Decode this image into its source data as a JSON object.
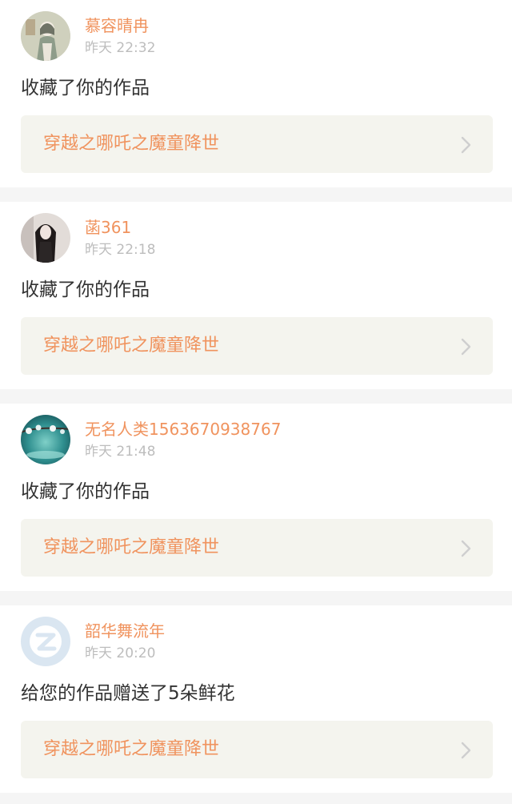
{
  "notifications": [
    {
      "user": "慕容晴冉",
      "time": "昨天 22:32",
      "action": "收藏了你的作品",
      "work_title": "穿越之哪吒之魔童降世",
      "avatar_icon": "avatar-girl-lantern",
      "avatar_colors": [
        "#c9c9b6",
        "#8d9a8a"
      ]
    },
    {
      "user": "菡361",
      "time": "昨天 22:18",
      "action": "收藏了你的作品",
      "work_title": "穿越之哪吒之魔童降世",
      "avatar_icon": "avatar-dark-hair-portrait",
      "avatar_colors": [
        "#d9d2cf",
        "#2a2222"
      ]
    },
    {
      "user": "无名人类1563670938767",
      "time": "昨天 21:48",
      "action": "收藏了你的作品",
      "work_title": "穿越之哪吒之魔童降世",
      "avatar_icon": "avatar-teal-blossom",
      "avatar_colors": [
        "#2f8f8f",
        "#cfe6e6"
      ]
    },
    {
      "user": "韶华舞流年",
      "time": "昨天 20:20",
      "action": "给您的作品赠送了5朵鲜花",
      "work_title": "穿越之哪吒之魔童降世",
      "avatar_icon": "avatar-default-z",
      "avatar_colors": [
        "#d9e6f2",
        "#ffffff"
      ]
    }
  ],
  "colors": {
    "accent": "#f0935e",
    "link_background": "#f4f4ee",
    "page_background": "#f5f5f5"
  }
}
